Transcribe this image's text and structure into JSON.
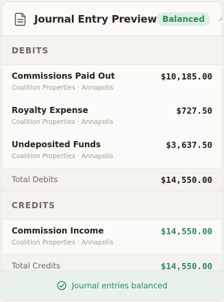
{
  "header": {
    "title": "Journal Entry Preview",
    "badge": "Balanced",
    "icons": {
      "document": "document-icon",
      "collapse": "chevron-up-icon"
    }
  },
  "debits": {
    "heading": "DEBITS",
    "lines": [
      {
        "account": "Commissions Paid Out",
        "office": "Coalition Properties",
        "location": "Annapolis",
        "amount": "$10,185.00"
      },
      {
        "account": "Royalty Expense",
        "office": "Coalition Properties",
        "location": "Annapolis",
        "amount": "$727.50"
      },
      {
        "account": "Undeposited Funds",
        "office": "Coalition Properties",
        "location": "Annapolis",
        "amount": "$3,637.50"
      }
    ],
    "total_label": "Total Debits",
    "total_amount": "$14,550.00"
  },
  "credits": {
    "heading": "CREDITS",
    "lines": [
      {
        "account": "Commission Income",
        "office": "Coalition Properties",
        "location": "Annapolis",
        "amount": "$14,550.00"
      }
    ],
    "total_label": "Total Credits",
    "total_amount": "$14,550.00"
  },
  "footer": {
    "message": "Journal entries balanced",
    "icon": "check-circle-icon"
  },
  "colors": {
    "accent_green": "#2f8a56",
    "badge_bg": "#ddf0e3",
    "footer_bg": "#e9f2ea"
  }
}
